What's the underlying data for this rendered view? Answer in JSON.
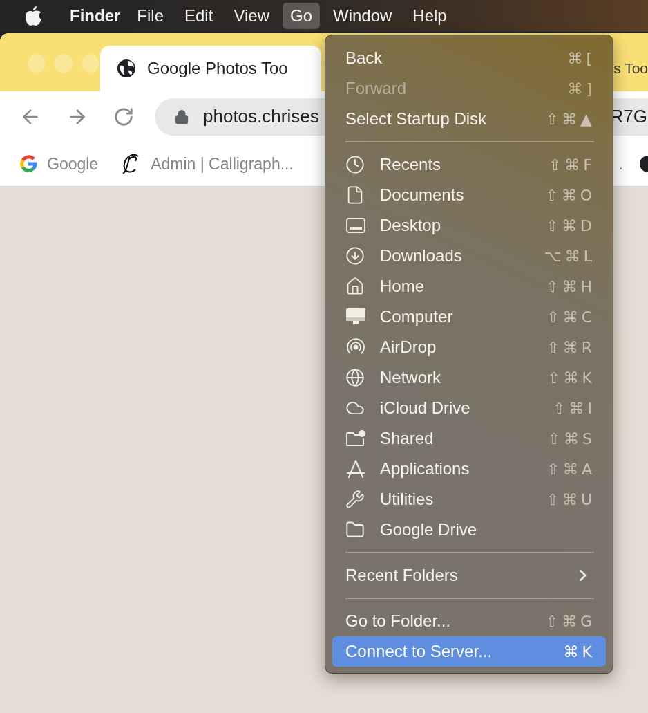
{
  "menu_bar": {
    "app_name": "Finder",
    "menus": [
      {
        "label": "File",
        "selected": false
      },
      {
        "label": "Edit",
        "selected": false
      },
      {
        "label": "View",
        "selected": false
      },
      {
        "label": "Go",
        "selected": true
      },
      {
        "label": "Window",
        "selected": false
      },
      {
        "label": "Help",
        "selected": false
      }
    ]
  },
  "browser": {
    "tabs": [
      {
        "title": "Google Photos Too",
        "selected": true
      },
      {
        "title": "s Too",
        "selected": false
      }
    ],
    "address": {
      "value_start": "photos.chrises",
      "value_end": "R7G"
    },
    "bookmarks": [
      {
        "label": "Google"
      },
      {
        "label": "Admin | Calligraph..."
      },
      {
        "label": "."
      }
    ]
  },
  "go_menu": {
    "sections": [
      {
        "items": [
          {
            "kind": "command",
            "label": "Back",
            "shortcut": "⌘[",
            "disabled": false,
            "selected": false
          },
          {
            "kind": "command",
            "label": "Forward",
            "shortcut": "⌘]",
            "disabled": true,
            "selected": false
          },
          {
            "kind": "command",
            "label": "Select Startup Disk",
            "shortcut": "⇧⌘▲",
            "disabled": false,
            "selected": false
          }
        ]
      },
      {
        "items": [
          {
            "kind": "place",
            "label": "Recents",
            "shortcut": "⇧⌘F",
            "disabled": false,
            "selected": false
          },
          {
            "kind": "place",
            "label": "Documents",
            "shortcut": "⇧⌘O",
            "disabled": false,
            "selected": false
          },
          {
            "kind": "place",
            "label": "Desktop",
            "shortcut": "⇧⌘D",
            "disabled": false,
            "selected": false
          },
          {
            "kind": "place",
            "label": "Downloads",
            "shortcut": "⌥⌘L",
            "disabled": false,
            "selected": false
          },
          {
            "kind": "place",
            "label": "Home",
            "shortcut": "⇧⌘H",
            "disabled": false,
            "selected": false
          },
          {
            "kind": "place",
            "label": "Computer",
            "shortcut": "⇧⌘C",
            "disabled": false,
            "selected": false
          },
          {
            "kind": "place",
            "label": "AirDrop",
            "shortcut": "⇧⌘R",
            "disabled": false,
            "selected": false
          },
          {
            "kind": "place",
            "label": "Network",
            "shortcut": "⇧⌘K",
            "disabled": false,
            "selected": false
          },
          {
            "kind": "place",
            "label": "iCloud Drive",
            "shortcut": "⇧⌘I",
            "disabled": false,
            "selected": false
          },
          {
            "kind": "place",
            "label": "Shared",
            "shortcut": "⇧⌘S",
            "disabled": false,
            "selected": false
          },
          {
            "kind": "place",
            "label": "Applications",
            "shortcut": "⇧⌘A",
            "disabled": false,
            "selected": false
          },
          {
            "kind": "place",
            "label": "Utilities",
            "shortcut": "⇧⌘U",
            "disabled": false,
            "selected": false
          },
          {
            "kind": "place",
            "label": "Google Drive",
            "disabled": false,
            "selected": false
          }
        ]
      },
      {
        "items": [
          {
            "kind": "submenu",
            "label": "Recent Folders",
            "disabled": false,
            "selected": false
          }
        ]
      },
      {
        "items": [
          {
            "kind": "command",
            "label": "Go to Folder...",
            "shortcut": "⇧⌘G",
            "disabled": false,
            "selected": false
          },
          {
            "kind": "command",
            "label": "Connect to Server...",
            "shortcut": "⌘K",
            "disabled": false,
            "selected": true
          }
        ]
      }
    ]
  }
}
